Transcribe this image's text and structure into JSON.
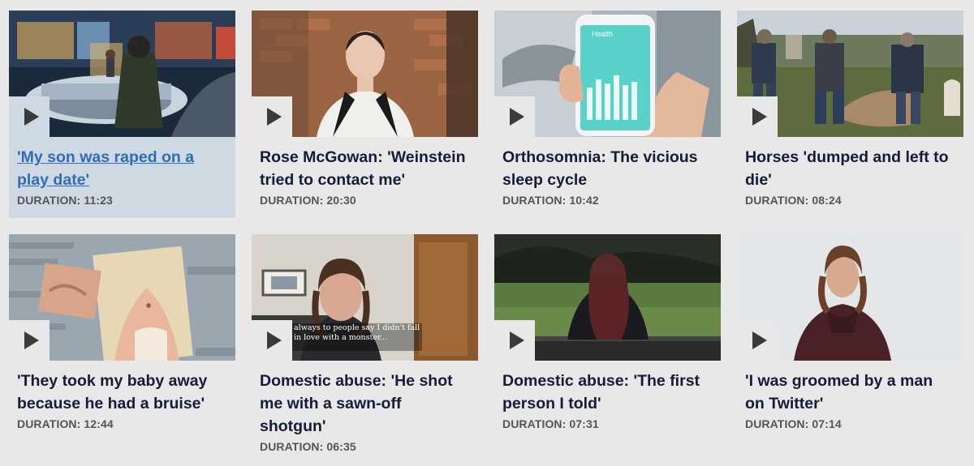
{
  "duration_label": "DURATION:",
  "videos": [
    {
      "title": "'My son was raped on a play date'",
      "duration": "11:23"
    },
    {
      "title": "Rose McGowan: 'Weinstein tried to contact me'",
      "duration": "20:30"
    },
    {
      "title": "Orthosomnia: The vicious sleep cycle",
      "duration": "10:42"
    },
    {
      "title": "Horses 'dumped and left to die'",
      "duration": "08:24"
    },
    {
      "title": "'They took my baby away because he had a bruise'",
      "duration": "12:44"
    },
    {
      "title": "Domestic abuse: 'He shot me with a sawn-off shotgun'",
      "duration": "06:35"
    },
    {
      "title": "Domestic abuse: 'The first person I told'",
      "duration": "07:31"
    },
    {
      "title": "'I was groomed by a man on Twitter'",
      "duration": "07:14"
    }
  ],
  "thumb_texts": {
    "phone_app": "Health",
    "subtitle": "always to people say I didn't fall in love with a monster..."
  },
  "icons": {
    "play": "play-icon"
  },
  "colors": {
    "background": "#e8e8e8",
    "active_card": "#cfd9e4",
    "active_link": "#2f6dbb",
    "title": "#141c3a",
    "duration": "#555555"
  }
}
